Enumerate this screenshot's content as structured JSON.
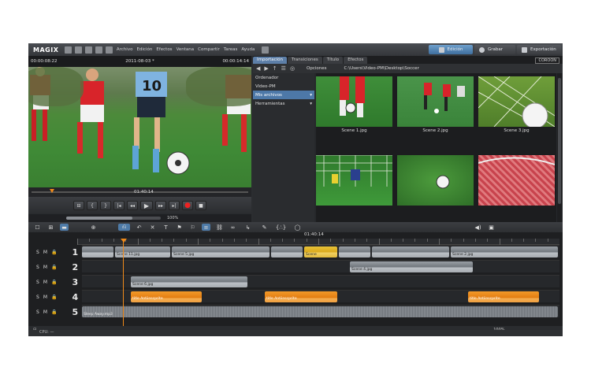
{
  "app": {
    "logo": "MAGIX",
    "menu": [
      "Archivo",
      "Edición",
      "Efectos",
      "Ventana",
      "Compartir",
      "Tareas",
      "Ayuda"
    ],
    "modes": {
      "edit": "Edición",
      "record": "Grabar",
      "export": "Exportación"
    }
  },
  "player": {
    "time_left": "00:00:08:22",
    "project": "2011-08-03 *",
    "time_right": "00:00:14:14",
    "scrub_time": "01:40:14",
    "zoom": "100%",
    "transport": [
      "⊟",
      "{",
      "}",
      "|◂",
      "◂◂",
      "▶",
      "▸▸",
      "▸|",
      "●",
      "■"
    ]
  },
  "pool": {
    "tabs": [
      "Importación",
      "Transiciones",
      "Título",
      "Efectos"
    ],
    "logo": "COROON",
    "options_label": "Opciones",
    "path": "C:\\Users\\Video-PM\\Desktop\\Soccer",
    "tree": [
      "Ordenador",
      "Video-PM",
      "Mis archivos",
      "Herramientas"
    ],
    "active_tree_index": 2,
    "thumbnails": [
      "Scene 1.jpg",
      "Scene 2.jpg",
      "Scene 3.jpg",
      "",
      "",
      ""
    ]
  },
  "timeline": {
    "ruler_time": "01:40:14",
    "tracks": [
      "1",
      "2",
      "3",
      "4",
      "5"
    ],
    "track_flags": [
      "S",
      "M",
      "🔒"
    ],
    "clips": {
      "c1": "Scene 11.jpg",
      "c2": "Scene 5.jpg",
      "c3": "Scene",
      "c4": "Scene 2.jpg",
      "c5": "Scene 4.jpg",
      "c6": "Scene 6.jpg",
      "c7": "title Antiinscprite",
      "c8": "title Antiinscprite",
      "c9": "title Antiinscprite",
      "audio": "Sleep Away.mp3"
    },
    "zoom": "100%"
  },
  "status": {
    "text": "CPU: —"
  },
  "colors": {
    "accent": "#4e7ba8",
    "orange": "#f08a1a",
    "gold": "#d9a71a"
  }
}
